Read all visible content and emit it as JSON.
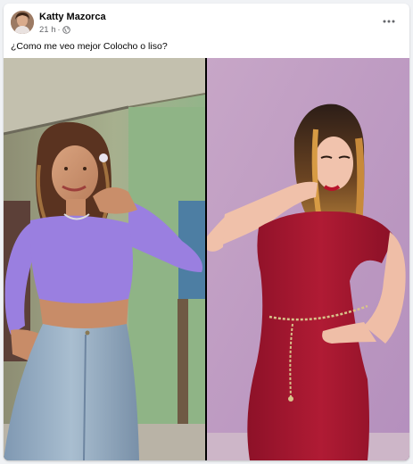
{
  "post": {
    "author": {
      "name": "Katty Mazorca"
    },
    "meta": {
      "time": "21 h",
      "separator": "·",
      "audience_icon": "globe-icon"
    },
    "more_icon": "more-horizontal-icon",
    "text": "¿Como me veo mejor Colocho o liso?",
    "photos": [
      {
        "name": "photo-curly-hair"
      },
      {
        "name": "photo-straight-hair"
      }
    ]
  },
  "colors": {
    "card_bg": "#ffffff",
    "page_bg": "#f0f2f5",
    "secondary_text": "#65676b",
    "lilac_top": "#9a7fe0",
    "red_dress": "#a3162e"
  }
}
